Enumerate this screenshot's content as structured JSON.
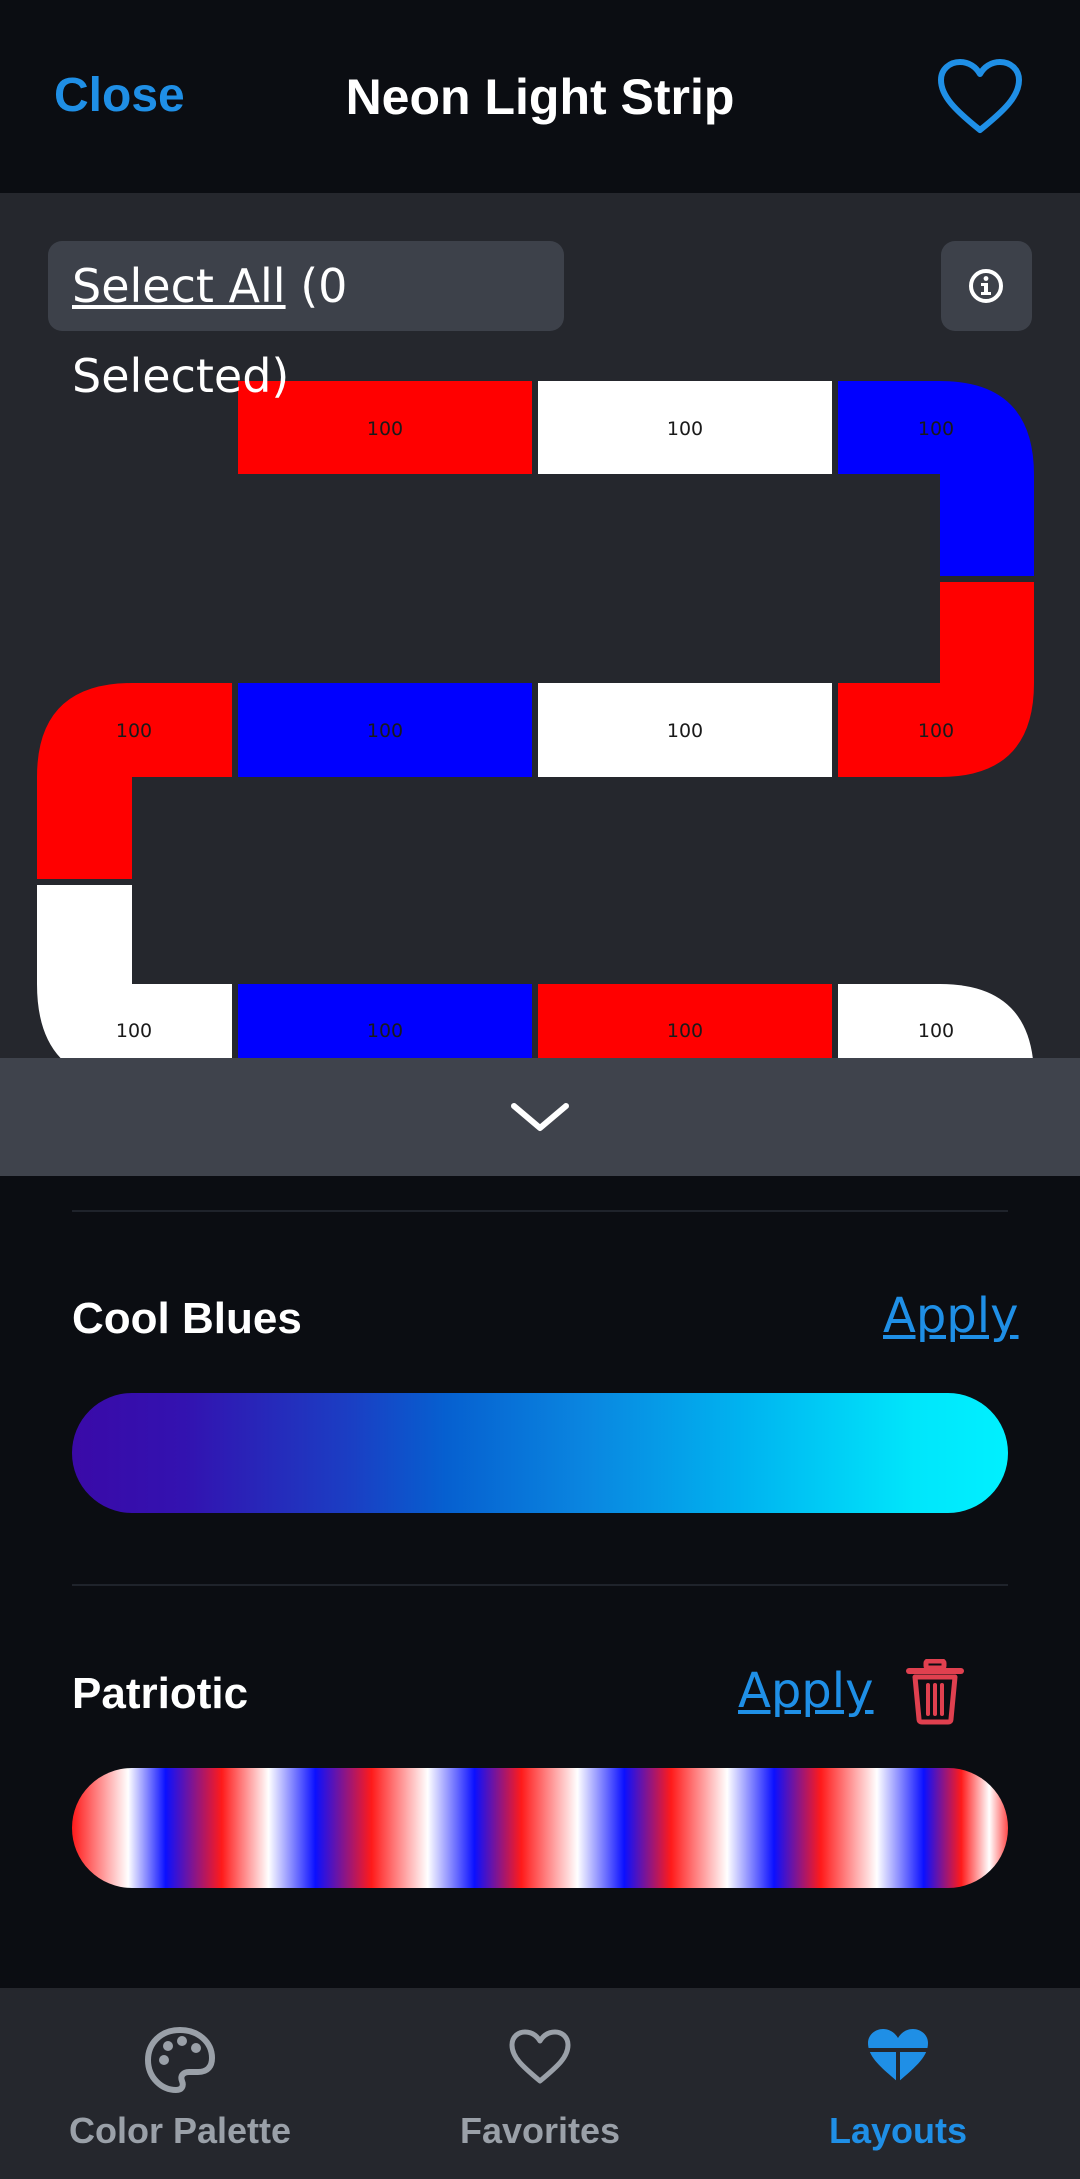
{
  "header": {
    "close_label": "Close",
    "title": "Neon Light Strip"
  },
  "editor": {
    "select_all_label": "Select All",
    "selected_count_text": "(0 Selected)",
    "segments": [
      {
        "color": "#ff0000",
        "value": "100"
      },
      {
        "color": "#ffffff",
        "value": "100"
      },
      {
        "color": "#0000ff",
        "value": "100"
      },
      {
        "color": "#ff0000",
        "value": "100"
      },
      {
        "color": "#ffffff",
        "value": "100"
      },
      {
        "color": "#0000ff",
        "value": "100"
      },
      {
        "color": "#ff0000",
        "value": "100"
      },
      {
        "color": "#ffffff",
        "value": "100"
      },
      {
        "color": "#0000ff",
        "value": "100"
      },
      {
        "color": "#ff0000",
        "value": "100"
      },
      {
        "color": "#ffffff",
        "value": "100"
      }
    ]
  },
  "palettes": [
    {
      "name": "Cool Blues",
      "apply_label": "Apply",
      "deletable": false
    },
    {
      "name": "Patriotic",
      "apply_label": "Apply",
      "deletable": true
    }
  ],
  "bottom_nav": [
    {
      "label": "Color Palette",
      "icon": "palette-icon",
      "active": false
    },
    {
      "label": "Favorites",
      "icon": "heart-icon",
      "active": false
    },
    {
      "label": "Layouts",
      "icon": "layouts-heart-icon",
      "active": true
    }
  ],
  "colors": {
    "accent": "#1f8fe6",
    "inactive_nav": "#9aa0a8",
    "delete": "#e0404f",
    "red": "#ff0000",
    "white": "#ffffff",
    "blue": "#0000ff"
  }
}
